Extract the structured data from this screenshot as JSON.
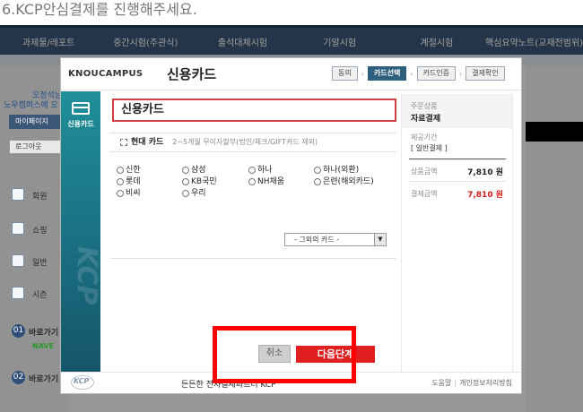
{
  "instruction": "6.KCP안심결제를 진행해주세요.",
  "site": {
    "nav": [
      "과제물/레포트",
      "중간시험(주관식)",
      "출석대체시험",
      "기말시험",
      "계절시험",
      "핵심요약노트(교재전범위)"
    ],
    "left_fragments": [
      "오정석님",
      "노우캠퍼스에 오",
      "마이페이지",
      "로그아웃",
      "회원",
      "쇼핑",
      "일반",
      "시즌",
      "바로가기",
      "NAVE",
      "바로가기"
    ],
    "badge_1": "01",
    "badge_2": "02"
  },
  "modal": {
    "brand": "KNOUCAMPUS",
    "title": "신용카드",
    "steps": [
      {
        "label": "동의",
        "active": false
      },
      {
        "label": "카드선택",
        "active": true
      },
      {
        "label": "카드인증",
        "active": false
      },
      {
        "label": "결제확인",
        "active": false
      }
    ],
    "step_arrow": "›",
    "sidebar_label": "신용카드",
    "watermark": "KCP",
    "payment_method": "신용카드",
    "card_type_label": "현대 카드",
    "card_type_desc": "2~5개월 무이자할부(법인/체크/GIFT카드 제외)",
    "banks": [
      [
        "신한",
        "삼성",
        "하나",
        "하나(외환)"
      ],
      [
        "롯데",
        "KB국민",
        "NH채움",
        "은련(해외카드)"
      ],
      [
        "비씨",
        "우리"
      ]
    ],
    "other_card_select": "- 그외의 카드 -",
    "select_arrow": "▼",
    "cancel_label": "취소",
    "next_label": "다음단계",
    "summary": {
      "product_label": "주문상품",
      "product_value": "자료결제",
      "period_label": "제공기간",
      "period_value": "[ 일반결제 ]",
      "amount_label": "상품금액",
      "amount_value": "7,810 원",
      "pay_label": "결제금액",
      "pay_value": "7,810 원"
    },
    "footer_logo": "KCP",
    "footer_text": "든든한 전자결제파트너 KCP",
    "help_link": "도움말",
    "link_sep": "|",
    "privacy_link": "개인정보처리방침"
  },
  "colors": {
    "accent_teal": "#1a7a88",
    "step_active": "#2e5f7d",
    "next_button": "#e02020",
    "highlight": "#ff0000",
    "amount_red": "#d41a1a"
  }
}
